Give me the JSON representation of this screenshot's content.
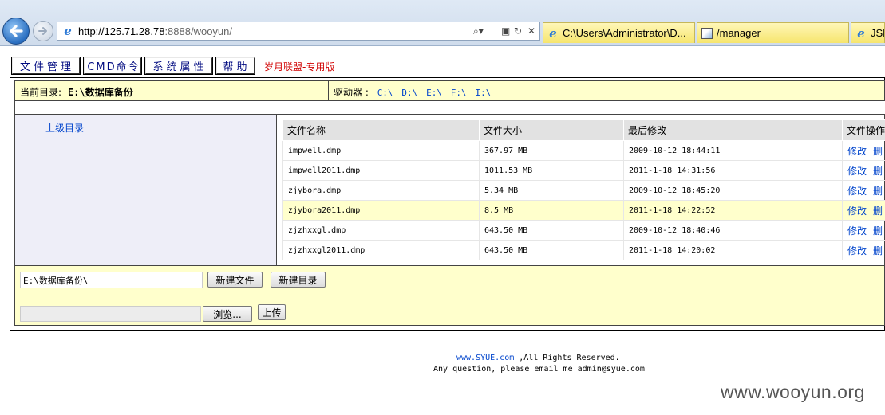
{
  "browser": {
    "address_host": "http://125.71.28.78",
    "address_rest": ":8888/wooyun/",
    "tabs": [
      {
        "label": "C:\\Users\\Administrator\\D...",
        "icon": "ie-icon"
      },
      {
        "label": "/manager",
        "icon": "page-icon"
      },
      {
        "label": "JSP",
        "icon": "ie-icon"
      }
    ]
  },
  "menu": {
    "items": [
      "文件管理",
      "CMD命令",
      "系统属性",
      "帮助"
    ],
    "brand": "岁月联盟-专用版"
  },
  "pathbar": {
    "current_label": "当前目录:",
    "current_path": "E:\\数据库备份",
    "drives_label": "驱动器 :",
    "drives": [
      "C:\\",
      "D:\\",
      "E:\\",
      "F:\\",
      "I:\\"
    ]
  },
  "left": {
    "parent_link": "上级目录"
  },
  "files": {
    "columns": [
      "文件名称",
      "文件大小",
      "最后修改",
      "文件操作"
    ],
    "op_edit": "修改",
    "op_delete": "删",
    "rows": [
      {
        "name": "impwell.dmp",
        "size": "367.97 MB",
        "modified": "2009-10-12 18:44:11"
      },
      {
        "name": "impwell2011.dmp",
        "size": "1011.53 MB",
        "modified": "2011-1-18 14:31:56"
      },
      {
        "name": "zjybora.dmp",
        "size": "5.34 MB",
        "modified": "2009-10-12 18:45:20"
      },
      {
        "name": "zjybora2011.dmp",
        "size": "8.5 MB",
        "modified": "2011-1-18 14:22:52"
      },
      {
        "name": "zjzhxxgl.dmp",
        "size": "643.50 MB",
        "modified": "2009-10-12 18:40:46"
      },
      {
        "name": "zjzhxxgl2011.dmp",
        "size": "643.50 MB",
        "modified": "2011-1-18 14:20:02"
      }
    ]
  },
  "bottom": {
    "path_value": "E:\\数据库备份\\",
    "new_file": "新建文件",
    "new_dir": "新建目录",
    "browse": "浏览...",
    "upload": "上传"
  },
  "footer": {
    "link": "www.SYUE.com",
    "rights": " ,All Rights Reserved.",
    "line2": "Any question, please email me admin@syue.com"
  },
  "watermark": "www.wooyun.org"
}
